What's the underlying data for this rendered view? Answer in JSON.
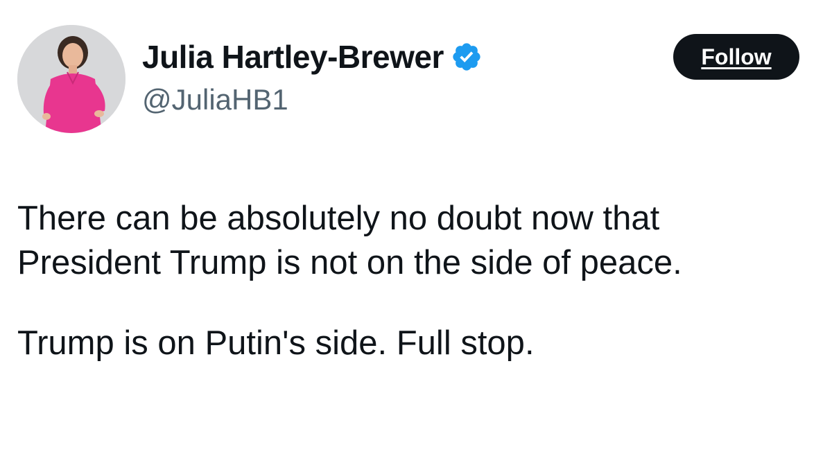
{
  "author": {
    "display_name": "Julia Hartley-Brewer",
    "handle": "@JuliaHB1",
    "verified": true
  },
  "follow_button": {
    "label": "Follow"
  },
  "tweet": {
    "paragraphs": [
      "There can be absolutely no doubt now that",
      "President Trump is not on the side of peace.",
      "Trump is on Putin's side. Full stop."
    ]
  },
  "icons": {
    "avatar": "avatar-photo",
    "verified": "verified-badge-icon"
  },
  "colors": {
    "text_primary": "#0f1419",
    "text_secondary": "#536471",
    "verified_blue": "#1d9bf0",
    "follow_bg": "#0f1419",
    "follow_text": "#ffffff",
    "avatar_dress": "#e8368f"
  }
}
